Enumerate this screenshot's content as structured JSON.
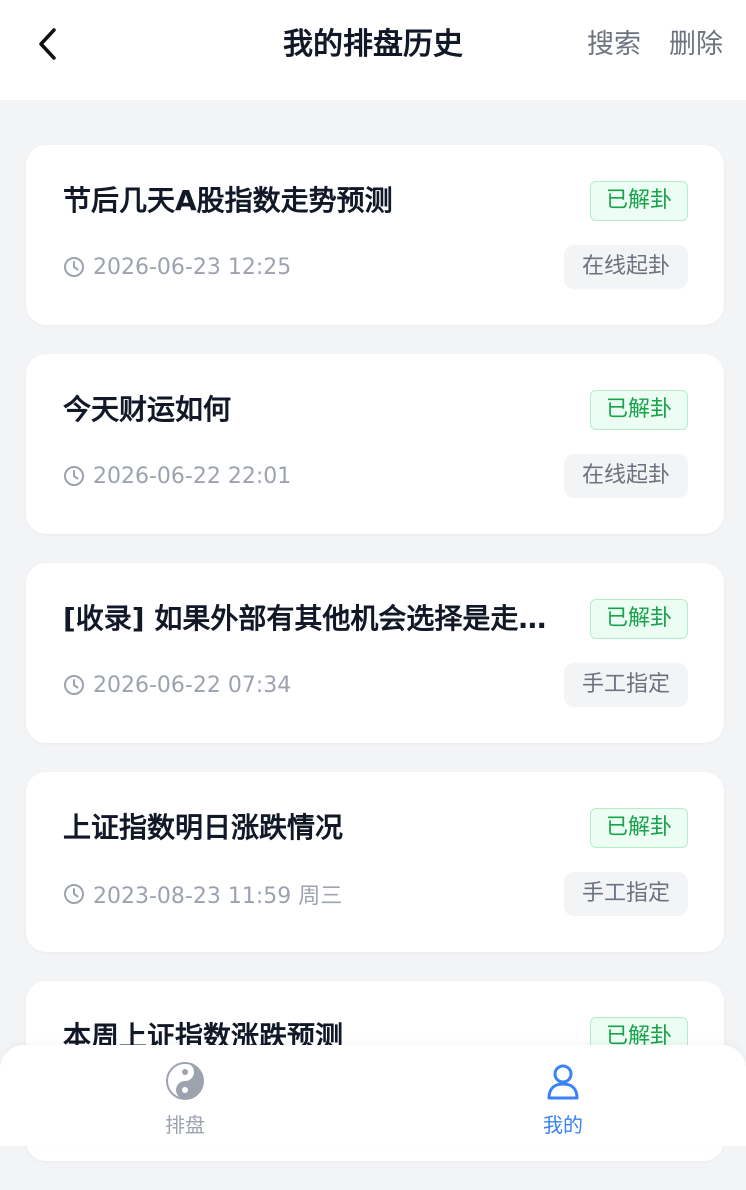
{
  "header": {
    "title": "我的排盘历史",
    "search_label": "搜索",
    "delete_label": "删除"
  },
  "records": [
    {
      "title": "节后几天A股指数走势预测",
      "status": "已解卦",
      "time": "2026-06-23 12:25",
      "method": "在线起卦"
    },
    {
      "title": "今天财运如何",
      "status": "已解卦",
      "time": "2026-06-22 22:01",
      "method": "在线起卦"
    },
    {
      "title": "[收录] 如果外部有其他机会选择是走还是留",
      "status": "已解卦",
      "time": "2026-06-22 07:34",
      "method": "手工指定"
    },
    {
      "title": "上证指数明日涨跌情况",
      "status": "已解卦",
      "time": "2023-08-23 11:59 周三",
      "method": "手工指定"
    },
    {
      "title": "本周上证指数涨跌预测",
      "status": "已解卦",
      "time": "",
      "method": ""
    }
  ],
  "bottom_nav": {
    "items": [
      {
        "label": "排盘",
        "icon": "yin-yang-icon",
        "active": false
      },
      {
        "label": "我的",
        "icon": "user-icon",
        "active": true
      }
    ]
  },
  "colors": {
    "accent": "#3b82f6",
    "status_green": "#16a34a",
    "muted": "#9ca3af"
  }
}
